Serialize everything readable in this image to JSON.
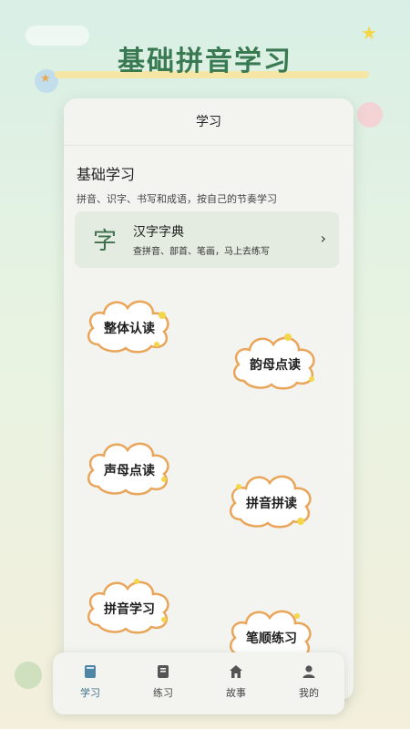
{
  "hero": {
    "title": "基础拼音学习"
  },
  "card": {
    "header": "学习",
    "section_title": "基础学习",
    "section_desc": "拼音、识字、书写和成语，按自己的节奏学习"
  },
  "dictionary": {
    "char": "字",
    "title": "汉字字典",
    "subtitle": "查拼音、部首、笔画，马上去练写",
    "chevron": "›"
  },
  "modules": [
    {
      "label": "整体认读"
    },
    {
      "label": "韵母点读"
    },
    {
      "label": "声母点读"
    },
    {
      "label": "拼音拼读"
    },
    {
      "label": "拼音学习"
    },
    {
      "label": "笔顺练习"
    }
  ],
  "tabs": [
    {
      "label": "学习",
      "icon": "book-icon",
      "active": true
    },
    {
      "label": "练习",
      "icon": "notebook-icon",
      "active": false
    },
    {
      "label": "故事",
      "icon": "home-icon",
      "active": false
    },
    {
      "label": "我的",
      "icon": "user-icon",
      "active": false
    }
  ],
  "colors": {
    "brand_green": "#3a7a52",
    "active_tab": "#3b6f8c",
    "cloud_border": "#e9a55a",
    "cloud_dot": "#f3d64a"
  }
}
